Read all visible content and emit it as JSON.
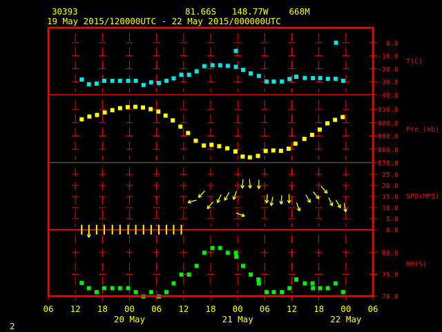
{
  "header": {
    "station": "30393",
    "location": "81.66S   148.77W    668M",
    "period": "19 May 2015/120000UTC - 22 May 2015/000000UTC"
  },
  "footer_label": "2",
  "colors": {
    "frame": "#ff0000",
    "text": "#ffff00",
    "temperature": "#00e5e5",
    "pressure": "#ffff00",
    "wind": "#ffff00",
    "rh": "#00ee00",
    "grid_alt": "#888888"
  },
  "chart_data": {
    "type": "scatter",
    "x_unit": "hours since 19 May 06 UTC",
    "xlim": [
      0,
      72
    ],
    "x_ticks": [
      "06",
      "12",
      "18",
      "00",
      "06",
      "12",
      "18",
      "00",
      "06",
      "12",
      "18",
      "00",
      "06"
    ],
    "date_labels": [
      {
        "text": "20 May",
        "hour": 18
      },
      {
        "text": "21 May",
        "hour": 42
      },
      {
        "text": "22 May",
        "hour": 66
      }
    ],
    "panels": [
      {
        "name": "temperature",
        "title": "T(C)",
        "ylim": [
          -40,
          0
        ],
        "ticks": [
          {
            "v": 0,
            "t": "0.0"
          },
          {
            "v": -10,
            "t": "-10.0"
          },
          {
            "v": -20,
            "t": "-20.0"
          },
          {
            "v": -30,
            "t": "-30.0"
          },
          {
            "v": -40,
            "t": "-40.0"
          }
        ],
        "points": [
          [
            7.4,
            -28.3
          ],
          [
            9.0,
            -31.9
          ],
          [
            10.7,
            -31.4
          ],
          [
            12.4,
            -29.3
          ],
          [
            14.2,
            -29.3
          ],
          [
            15.9,
            -29.3
          ],
          [
            17.7,
            -29.3
          ],
          [
            19.4,
            -29.3
          ],
          [
            21.1,
            -32.5
          ],
          [
            22.8,
            -30.5
          ],
          [
            24.5,
            -30.9
          ],
          [
            26.2,
            -29.3
          ],
          [
            27.8,
            -27.4
          ],
          [
            29.5,
            -24.6
          ],
          [
            31.2,
            -24.6
          ],
          [
            32.9,
            -22.0
          ],
          [
            34.6,
            -18.0
          ],
          [
            36.4,
            -17.3
          ],
          [
            38.1,
            -17.3
          ],
          [
            39.8,
            -17.8
          ],
          [
            41.6,
            -18.5
          ],
          [
            41.6,
            -6.3
          ],
          [
            43.2,
            -20.9
          ],
          [
            44.9,
            -23.6
          ],
          [
            46.7,
            -25.5
          ],
          [
            48.4,
            -29.8
          ],
          [
            50.0,
            -29.8
          ],
          [
            51.8,
            -29.8
          ],
          [
            53.5,
            -27.9
          ],
          [
            55.0,
            -26.2
          ],
          [
            56.9,
            -27.1
          ],
          [
            58.7,
            -27.2
          ],
          [
            60.3,
            -27.2
          ],
          [
            62.0,
            -27.7
          ],
          [
            63.7,
            -27.7
          ],
          [
            63.8,
            0.0
          ],
          [
            65.4,
            -29.3
          ]
        ]
      },
      {
        "name": "pressure",
        "title": "Pre (mb)",
        "ylim": [
          870,
          920
        ],
        "ticks": [
          {
            "v": 910,
            "t": "910.0"
          },
          {
            "v": 900,
            "t": "900.0"
          },
          {
            "v": 890,
            "t": "890.0"
          },
          {
            "v": 880,
            "t": "880.0"
          },
          {
            "v": 870,
            "t": "870.0"
          }
        ],
        "points": [
          [
            7.4,
            902.5
          ],
          [
            9.1,
            904.6
          ],
          [
            10.8,
            905.8
          ],
          [
            12.5,
            907.7
          ],
          [
            14.2,
            909.4
          ],
          [
            15.9,
            910.9
          ],
          [
            17.6,
            911.7
          ],
          [
            19.3,
            911.9
          ],
          [
            21.0,
            911.4
          ],
          [
            22.7,
            910.2
          ],
          [
            24.4,
            908.3
          ],
          [
            26.0,
            905.3
          ],
          [
            27.6,
            901.7
          ],
          [
            29.3,
            897.0
          ],
          [
            31.0,
            892.2
          ],
          [
            32.7,
            886.4
          ],
          [
            34.5,
            882.8
          ],
          [
            36.2,
            883.3
          ],
          [
            37.9,
            882.3
          ],
          [
            39.7,
            880.7
          ],
          [
            41.5,
            878.3
          ],
          [
            43.1,
            874.5
          ],
          [
            44.7,
            873.9
          ],
          [
            46.5,
            875.0
          ],
          [
            48.2,
            878.7
          ],
          [
            49.9,
            879.1
          ],
          [
            51.6,
            878.8
          ],
          [
            53.3,
            880.4
          ],
          [
            54.8,
            884.2
          ],
          [
            56.8,
            887.8
          ],
          [
            58.5,
            890.8
          ],
          [
            60.2,
            894.8
          ],
          [
            61.9,
            899.5
          ],
          [
            63.6,
            902.1
          ],
          [
            65.3,
            904.2
          ]
        ]
      },
      {
        "name": "wind",
        "title": "SPD(MPS)",
        "ylim": [
          0,
          30
        ],
        "ticks": [
          {
            "v": 25,
            "t": "25.0"
          },
          {
            "v": 20,
            "t": "20.0"
          },
          {
            "v": 15,
            "t": "15.0"
          },
          {
            "v": 10,
            "t": "10.0"
          },
          {
            "v": 5,
            "t": "5.0"
          },
          {
            "v": 0,
            "t": "0.0"
          }
        ],
        "calm_hours": [
          7.4,
          9.0,
          10.7,
          12.4,
          14.2,
          15.9,
          17.7,
          19.4,
          21.1,
          22.8,
          24.5,
          26.2,
          27.8,
          29.5
        ],
        "points": [
          [
            9.0,
            -1.5,
            0
          ],
          [
            31.9,
            12.8,
            75
          ],
          [
            34.0,
            16,
            45
          ],
          [
            35.9,
            11,
            40
          ],
          [
            37.9,
            14,
            25
          ],
          [
            39.6,
            15,
            30
          ],
          [
            41.4,
            15.5,
            20
          ],
          [
            42.6,
            6.8,
            290
          ],
          [
            43.1,
            20.7,
            5
          ],
          [
            44.7,
            20.7,
            355
          ],
          [
            46.7,
            20.5,
            0
          ],
          [
            48.5,
            14,
            5
          ],
          [
            49.6,
            12.8,
            10
          ],
          [
            51.7,
            13.5,
            5
          ],
          [
            53.4,
            14,
            0
          ],
          [
            55.4,
            10.3,
            340
          ],
          [
            57.6,
            14,
            330
          ],
          [
            59.4,
            15.5,
            320
          ],
          [
            61.2,
            18,
            320
          ],
          [
            62.6,
            12.6,
            335
          ],
          [
            64.3,
            11.6,
            330
          ],
          [
            65.8,
            10,
            350
          ]
        ]
      },
      {
        "name": "rh",
        "title": "RH(%)",
        "ylim": [
          70,
          85
        ],
        "ticks": [
          {
            "v": 80,
            "t": "80.0"
          },
          {
            "v": 75,
            "t": "75.0"
          },
          {
            "v": 70,
            "t": "70.0"
          }
        ],
        "points": [
          [
            7.4,
            73.0
          ],
          [
            9.0,
            71.8
          ],
          [
            10.7,
            70.9
          ],
          [
            12.4,
            71.8
          ],
          [
            14.2,
            71.8
          ],
          [
            15.9,
            71.8
          ],
          [
            17.7,
            71.8
          ],
          [
            19.4,
            70.9
          ],
          [
            21.1,
            69.9
          ],
          [
            22.8,
            70.9
          ],
          [
            24.5,
            69.9
          ],
          [
            26.2,
            70.9
          ],
          [
            27.8,
            72.9
          ],
          [
            29.5,
            74.9
          ],
          [
            31.2,
            74.9
          ],
          [
            32.9,
            76.9
          ],
          [
            34.6,
            79.9
          ],
          [
            36.4,
            81.0
          ],
          [
            38.1,
            81.0
          ],
          [
            39.8,
            79.9
          ],
          [
            41.6,
            79.9
          ],
          [
            41.7,
            79.0
          ],
          [
            43.2,
            76.9
          ],
          [
            44.9,
            74.9
          ],
          [
            46.6,
            73.8
          ],
          [
            46.7,
            72.9
          ],
          [
            48.4,
            70.9
          ],
          [
            50.0,
            70.9
          ],
          [
            51.8,
            70.9
          ],
          [
            53.5,
            71.8
          ],
          [
            55.0,
            73.8
          ],
          [
            56.9,
            72.9
          ],
          [
            58.6,
            72.9
          ],
          [
            58.7,
            71.8
          ],
          [
            60.3,
            71.8
          ],
          [
            62.0,
            71.8
          ],
          [
            63.7,
            72.9
          ],
          [
            65.4,
            70.9
          ]
        ]
      }
    ]
  }
}
